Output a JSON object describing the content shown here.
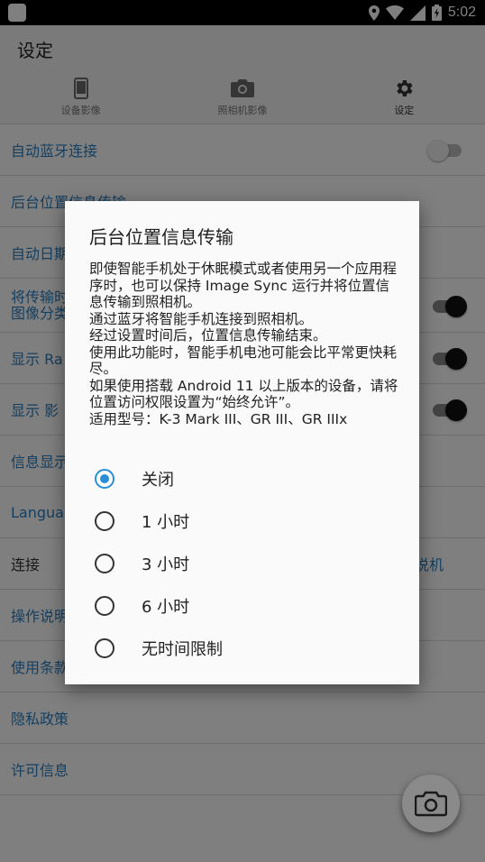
{
  "status": {
    "time": "5:02"
  },
  "app": {
    "title": "设定",
    "tabs": [
      {
        "label": "设备影像",
        "icon": "phone-icon"
      },
      {
        "label": "照相机影像",
        "icon": "camera-icon"
      },
      {
        "label": "设定",
        "icon": "gear-icon"
      }
    ]
  },
  "settings": [
    {
      "label": "自动蓝牙连接",
      "toggle": "off"
    },
    {
      "label": "后台位置信息传输"
    },
    {
      "label": "自动日期"
    },
    {
      "label": "将传输时\n图像分类",
      "toggle": "on"
    },
    {
      "label": "显示 Ra",
      "toggle": "on"
    },
    {
      "label": "显示 影",
      "toggle": "on"
    },
    {
      "label": "信息显示"
    },
    {
      "label": "Languag"
    },
    {
      "label": "连接",
      "right": "说机"
    },
    {
      "label": "操作说明"
    },
    {
      "label": "使用条款"
    },
    {
      "label": "隐私政策"
    },
    {
      "label": "许可信息"
    }
  ],
  "dialog": {
    "title": "后台位置信息传输",
    "message": "即使智能手机处于休眠模式或者使用另一个应用程序时，也可以保持 Image Sync 运行并将位置信息传输到照相机。\n通过蓝牙将智能手机连接到照相机。\n经过设置时间后，位置信息传输结束。\n使用此功能时，智能手机电池可能会比平常更快耗尽。\n如果使用搭载 Android 11 以上版本的设备，请将位置访问权限设置为“始终允许”。\n适用型号：K-3 Mark III、GR III、GR IIIx",
    "options": [
      {
        "label": "关闭",
        "selected": true
      },
      {
        "label": "1 小时",
        "selected": false
      },
      {
        "label": "3 小时",
        "selected": false
      },
      {
        "label": "6 小时",
        "selected": false
      },
      {
        "label": "无时间限制",
        "selected": false
      }
    ]
  },
  "colors": {
    "accent": "#2a8ed6",
    "link": "#2a7fc0"
  }
}
